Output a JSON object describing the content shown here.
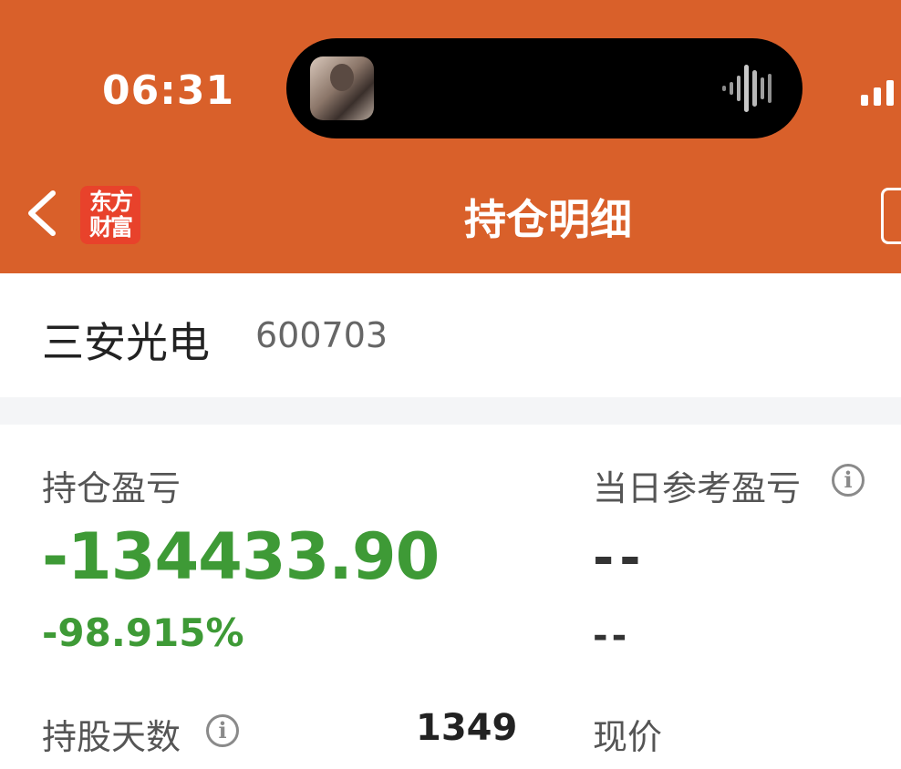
{
  "status_bar": {
    "time": "06:31"
  },
  "nav": {
    "title": "持仓明细",
    "logo_line1": "东方",
    "logo_line2": "财富"
  },
  "stock": {
    "name": "三安光电",
    "code": "600703"
  },
  "position": {
    "pl_label": "持仓盈亏",
    "pl_value": "-134433.90",
    "pl_percent": "-98.915%",
    "daily_label": "当日参考盈亏",
    "daily_value": "--",
    "daily_percent": "--",
    "days_label": "持股天数",
    "days_value": "1349",
    "price_label": "现价"
  },
  "colors": {
    "header": "#d9602a",
    "gain_loss": "#3e9a36",
    "logo": "#e8422b"
  },
  "icons": [
    "back-chevron-icon",
    "app-logo",
    "info-icon",
    "signal-icon",
    "audio-wave-icon"
  ]
}
